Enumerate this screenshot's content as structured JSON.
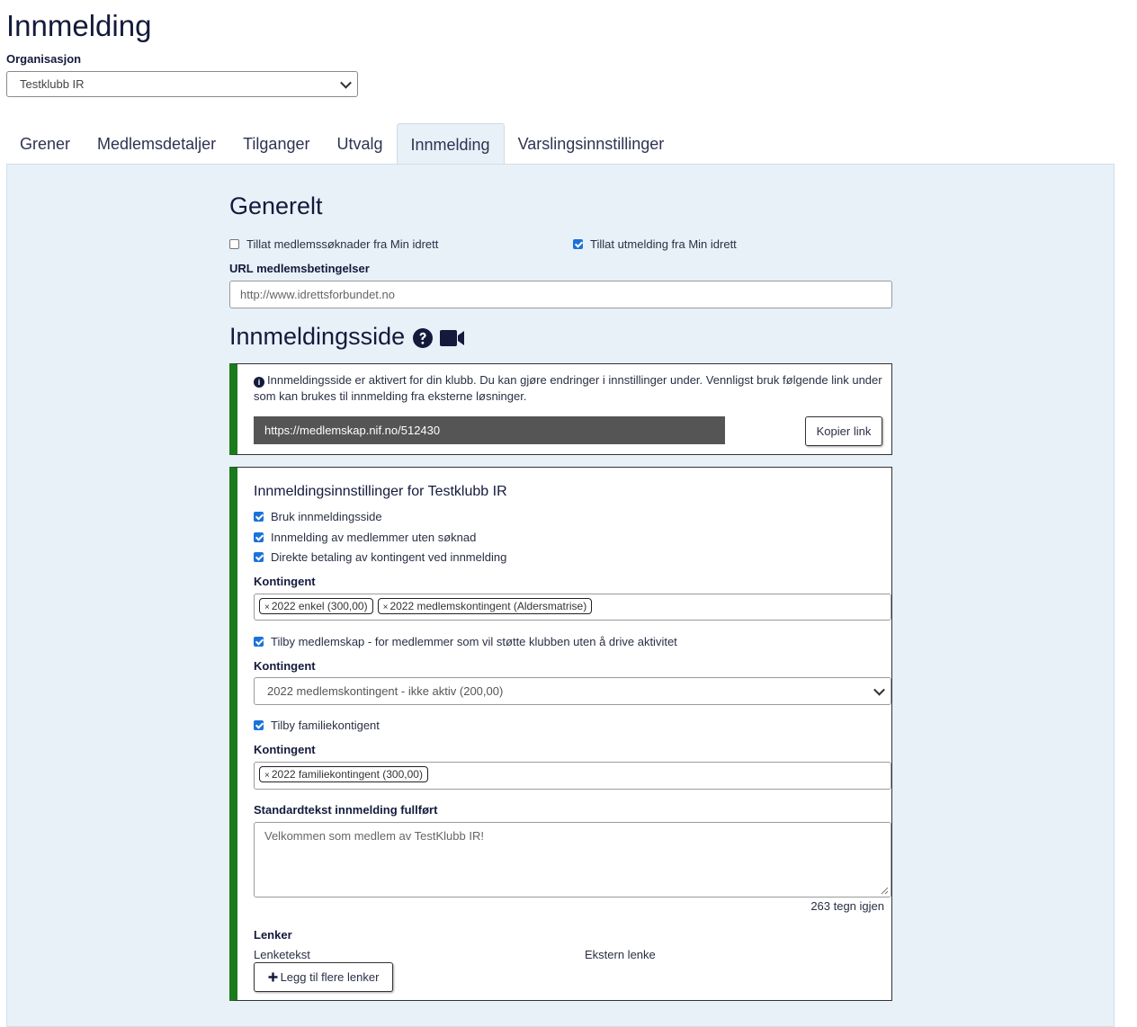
{
  "page_title": "Innmelding",
  "organisation": {
    "label": "Organisasjon",
    "selected": "Testklubb IR"
  },
  "tabs": [
    {
      "label": "Grener"
    },
    {
      "label": "Medlemsdetaljer"
    },
    {
      "label": "Tilganger"
    },
    {
      "label": "Utvalg"
    },
    {
      "label": "Innmelding",
      "active": true
    },
    {
      "label": "Varslingsinnstillinger"
    }
  ],
  "general": {
    "heading": "Generelt",
    "allow_applications": {
      "label": "Tillat medlemssøknader fra Min idrett",
      "checked": false
    },
    "allow_unsubscribe": {
      "label": "Tillat utmelding fra Min idrett",
      "checked": true
    },
    "url_label": "URL medlemsbetingelser",
    "url_placeholder": "http://www.idrettsforbundet.no"
  },
  "signup_page": {
    "heading": "Innmeldingsside",
    "info_icon": "i",
    "info_text": "Innmeldingsside er aktivert for din klubb. Du kan gjøre endringer i innstillinger under. Vennligst bruk følgende link under som kan brukes til innmelding fra eksterne løsninger.",
    "link": "https://medlemskap.nif.no/512430",
    "copy_button": "Kopier link"
  },
  "settings": {
    "heading": "Innmeldingsinnstillinger for Testklubb IR",
    "use_signup_page": {
      "label": "Bruk innmeldingsside",
      "checked": true
    },
    "signup_without_application": {
      "label": "Innmelding av medlemmer uten søknad",
      "checked": true
    },
    "direct_payment": {
      "label": "Direkte betaling av kontingent ved innmelding",
      "checked": true
    },
    "kontingent_label": "Kontingent",
    "kontingent_tags": [
      "2022 enkel (300,00)",
      "2022 medlemskontingent (Aldersmatrise)"
    ],
    "tag_remove": "×",
    "offer_membership": {
      "label": "Tilby medlemskap - for medlemmer som vil støtte klubben uten å drive aktivitet",
      "checked": true
    },
    "support_kontingent_selected": "2022 medlemskontingent - ikke aktiv (200,00)",
    "offer_family": {
      "label": "Tilby familiekontigent",
      "checked": true
    },
    "family_tags": [
      "2022 familiekontingent (300,00)"
    ],
    "completion_text_label": "Standardtekst innmelding fullført",
    "completion_text_placeholder": "Velkommen som medlem av TestKlubb IR!",
    "chars_left": "263 tegn igjen",
    "links_label": "Lenker",
    "link_text_label": "Lenketekst",
    "external_link_label": "Ekstern lenke",
    "add_links_button": "Legg til flere lenker"
  }
}
